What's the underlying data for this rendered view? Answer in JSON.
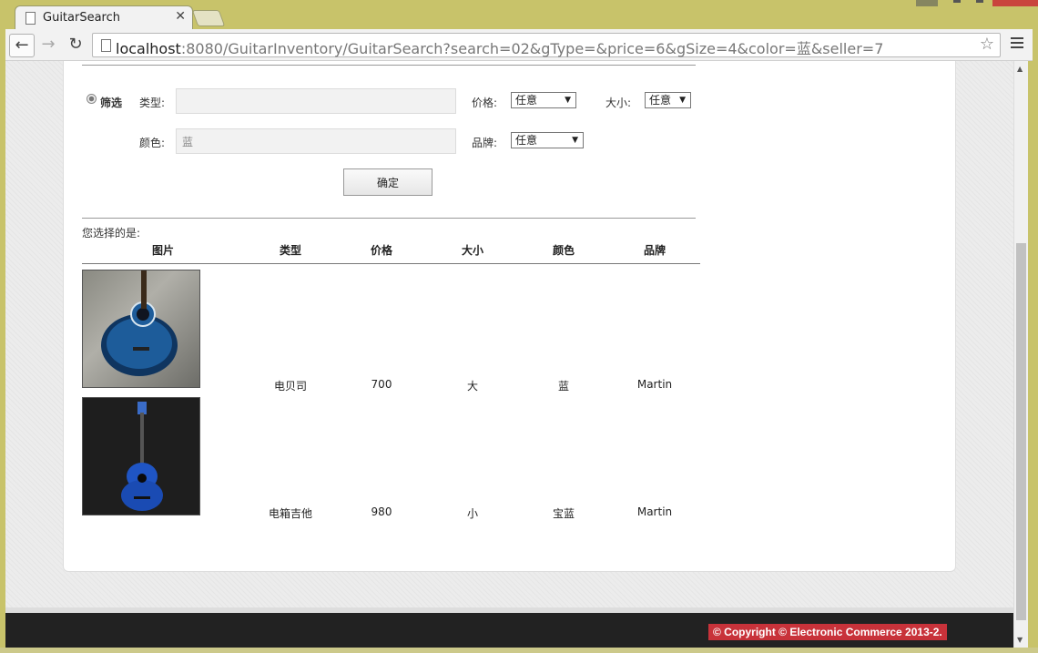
{
  "browser": {
    "tab_title": "GuitarSearch",
    "url_host": "localhost",
    "url_rest": ":8080/GuitarInventory/GuitarSearch?search=02&gType=&price=6&gSize=4&color=蓝&seller=7"
  },
  "filter": {
    "radio_label": "筛选",
    "type_label": "类型:",
    "type_value": "",
    "price_label": "价格:",
    "price_value": "任意",
    "size_label": "大小:",
    "size_value": "任意",
    "color_label": "颜色:",
    "color_value": "蓝",
    "brand_label": "品牌:",
    "brand_value": "任意",
    "submit_label": "确定"
  },
  "results": {
    "caption": "您选择的是:",
    "headers": [
      "图片",
      "类型",
      "价格",
      "大小",
      "颜色",
      "品牌"
    ],
    "rows": [
      {
        "type": "电贝司",
        "price": "700",
        "size": "大",
        "color": "蓝",
        "brand": "Martin"
      },
      {
        "type": "电箱吉他",
        "price": "980",
        "size": "小",
        "color": "宝蓝",
        "brand": "Martin"
      }
    ]
  },
  "footer": {
    "copyright": "© Copyright © Electronic Commerce 2013-2."
  },
  "colors": {
    "footer_bg": "#222222",
    "copyright_bg": "#c8323a"
  }
}
